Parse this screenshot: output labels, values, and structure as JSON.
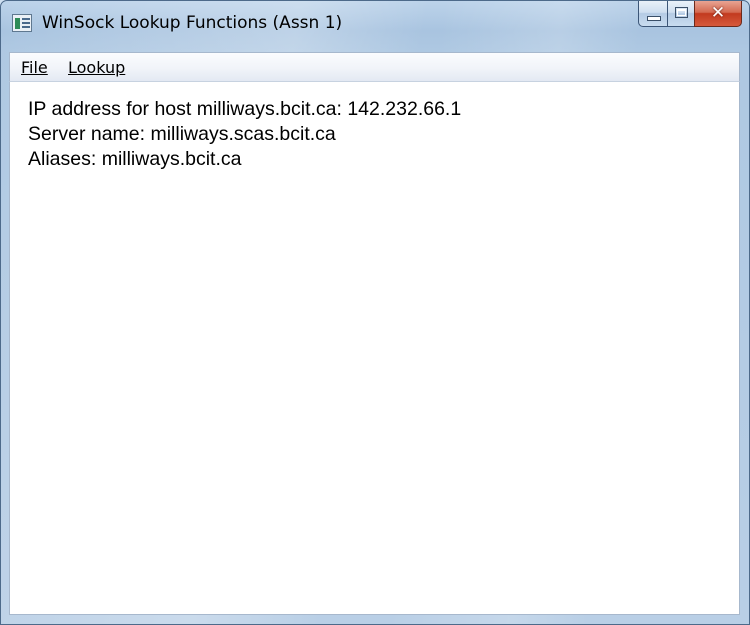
{
  "window": {
    "title": "WinSock Lookup Functions (Assn 1)",
    "app_icon": "window-app-icon",
    "caption_buttons": {
      "minimize_icon": "minimize-icon",
      "maximize_icon": "maximize-icon",
      "close_icon": "close-icon",
      "close_glyph": "✕"
    }
  },
  "menubar": {
    "items": [
      {
        "label": "File"
      },
      {
        "label": "Lookup"
      }
    ]
  },
  "output": {
    "lines": [
      "IP address for host milliways.bcit.ca: 142.232.66.1",
      "Server name: milliways.scas.bcit.ca",
      "Aliases: milliways.bcit.ca"
    ]
  },
  "colors": {
    "frame": "#a9c4e0",
    "close_button": "#c23a1f",
    "client_background": "#ffffff"
  }
}
